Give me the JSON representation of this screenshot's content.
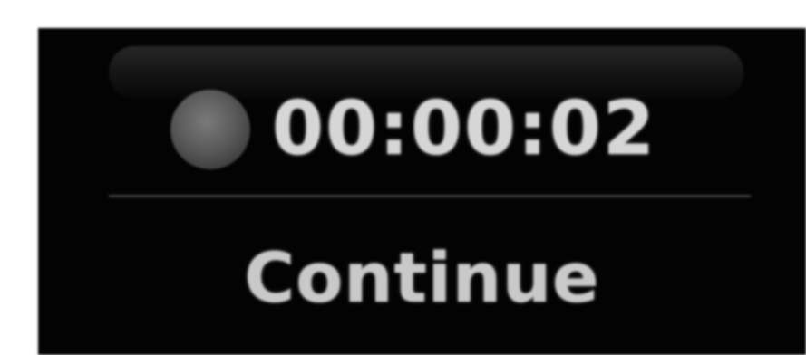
{
  "osd": {
    "timer": "00:00:02",
    "status_label": "Continue",
    "record_icon": "record-dot-icon"
  }
}
